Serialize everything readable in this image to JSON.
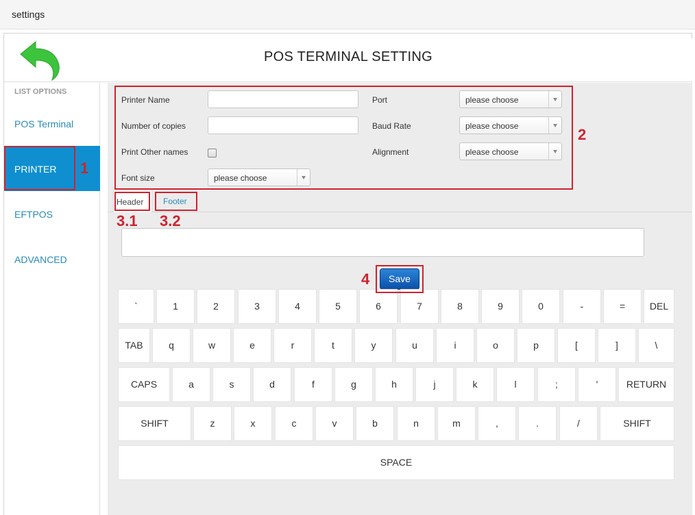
{
  "window": {
    "title": "settings"
  },
  "header": {
    "title": "POS TERMINAL SETTING",
    "back_icon": "back-arrow-icon",
    "back_color": "#3cc43c"
  },
  "sidebar": {
    "heading": "LIST OPTIONS",
    "items": [
      {
        "label": "POS Terminal",
        "active": false
      },
      {
        "label": "PRINTER",
        "active": true
      },
      {
        "label": "EFTPOS",
        "active": false
      },
      {
        "label": "ADVANCED",
        "active": false
      }
    ]
  },
  "form": {
    "printer_name": {
      "label": "Printer Name",
      "value": ""
    },
    "copies": {
      "label": "Number of copies",
      "value": ""
    },
    "other_names": {
      "label": "Print Other names",
      "checked": false
    },
    "font_size": {
      "label": "Font size",
      "value": "please choose"
    },
    "port": {
      "label": "Port",
      "value": "please choose"
    },
    "baud_rate": {
      "label": "Baud Rate",
      "value": "please choose"
    },
    "alignment": {
      "label": "Alignment",
      "value": "please choose"
    }
  },
  "tabs": [
    {
      "label": "Header",
      "active": true
    },
    {
      "label": "Footer",
      "active": false
    }
  ],
  "textarea": {
    "value": ""
  },
  "save_label": "Save",
  "annotations": [
    "1",
    "2",
    "3.1",
    "3.2",
    "4"
  ],
  "annotation_color": "#d0222e",
  "accent_color": "#0f8fd0",
  "keyboard": {
    "rows": [
      [
        "`",
        "1",
        "2",
        "3",
        "4",
        "5",
        "6",
        "7",
        "8",
        "9",
        "0",
        "-",
        "=",
        "DEL"
      ],
      [
        "TAB",
        "q",
        "w",
        "e",
        "r",
        "t",
        "y",
        "u",
        "i",
        "o",
        "p",
        "[",
        "]",
        "\\"
      ],
      [
        "CAPS",
        "a",
        "s",
        "d",
        "f",
        "g",
        "h",
        "j",
        "k",
        "l",
        ";",
        "'",
        "RETURN"
      ],
      [
        "SHIFT",
        "z",
        "x",
        "c",
        "v",
        "b",
        "n",
        "m",
        ",",
        ".",
        "/",
        "SHIFT"
      ],
      [
        "SPACE"
      ]
    ]
  }
}
